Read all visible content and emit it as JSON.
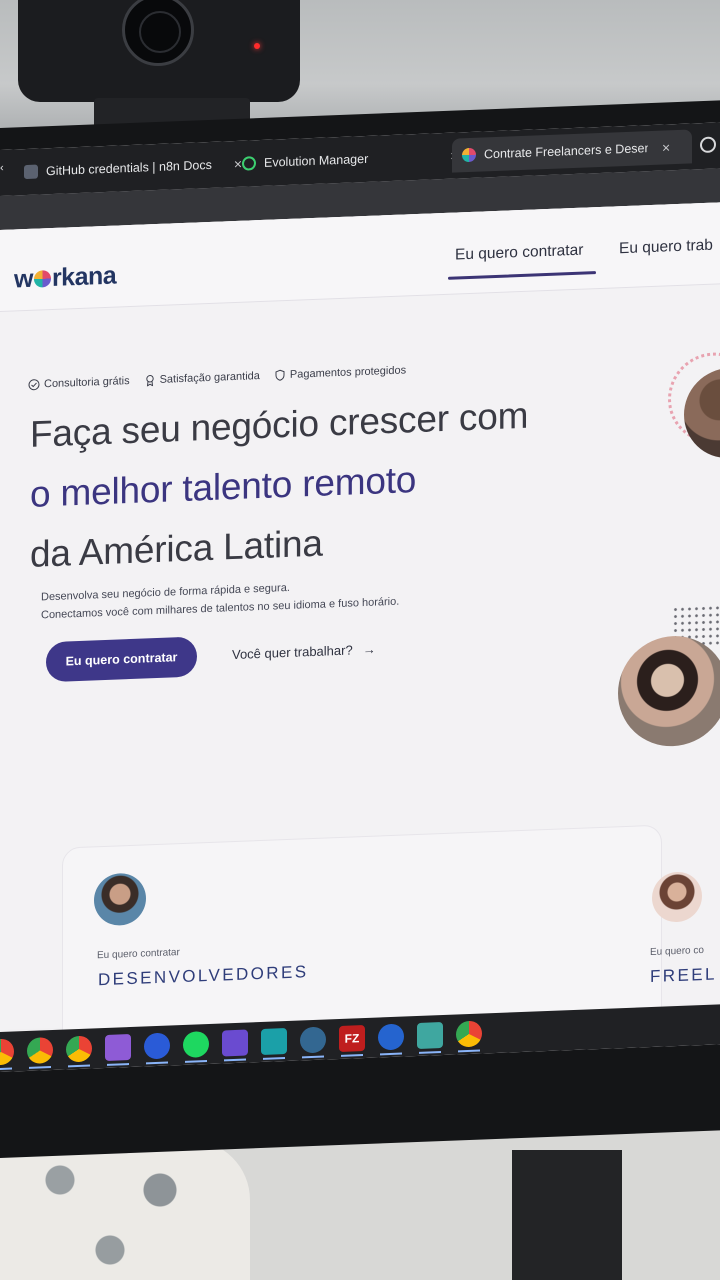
{
  "browser": {
    "tabs": [
      {
        "title": "GitHub credentials | n8n Docs",
        "icon": "n8n-docs-icon",
        "active": false
      },
      {
        "title": "Evolution Manager",
        "icon": "chat-bubble-icon",
        "active": false
      },
      {
        "title": "Contrate Freelancers e Desenvo",
        "icon": "workana-favicon",
        "active": true
      }
    ],
    "close_glyph": "×"
  },
  "site": {
    "logo": "workana",
    "nav": {
      "hire": "Eu quero contratar",
      "work": "Eu quero trab"
    }
  },
  "hero": {
    "badges": [
      {
        "label": "Consultoria grátis",
        "icon": "check-circle-icon"
      },
      {
        "label": "Satisfação garantida",
        "icon": "ribbon-icon"
      },
      {
        "label": "Pagamentos protegidos",
        "icon": "shield-icon"
      }
    ],
    "headline_line1": "Faça seu negócio crescer com",
    "headline_line2": "o melhor talento remoto",
    "headline_line3": "da América Latina",
    "sub_line1": "Desenvolva seu negócio de forma rápida e segura.",
    "sub_line2": "Conectamos você com milhares de talentos no seu idioma e fuso horário.",
    "cta_primary": "Eu quero contratar",
    "cta_secondary": "Você quer trabalhar?",
    "cta_secondary_arrow": "→"
  },
  "cards": [
    {
      "kicker": "Eu quero contratar",
      "title": "DESENVOLVEDORES"
    },
    {
      "kicker": "Eu quero co",
      "title": "FREEL"
    }
  ],
  "taskbar": {
    "icons": [
      "chrome-icon",
      "chrome-icon",
      "mail-icon",
      "vpn-icon",
      "spotify-icon",
      "app-icon",
      "store-icon",
      "postgres-icon",
      "filezilla-icon",
      "todo-icon",
      "notes-icon",
      "chrome-icon"
    ],
    "filezilla_label": "FZ"
  },
  "colors": {
    "brand": "#3e3789",
    "headline_accent": "#3b3580",
    "card_title": "#2f3d7a"
  }
}
